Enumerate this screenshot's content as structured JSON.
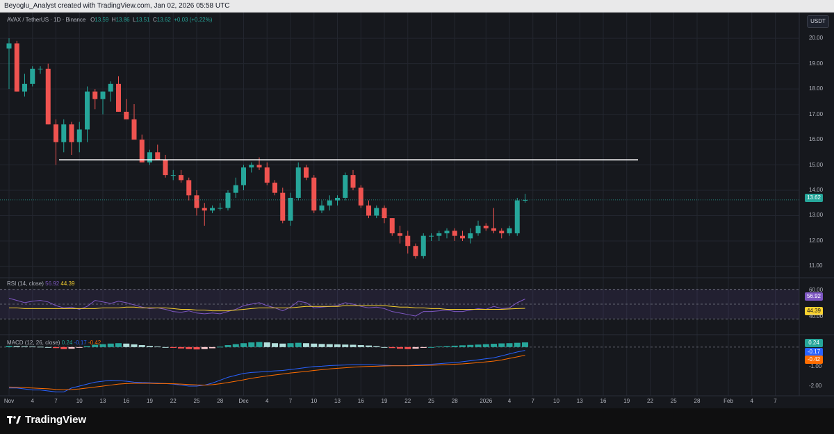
{
  "header": {
    "credit": "Beyoglu_Analyst created with TradingView.com, Jan 02, 2026 05:58 UTC"
  },
  "symbol": {
    "title": "AVAX / TetherUS · 1D · Binance",
    "open_label": "O",
    "open": "13.59",
    "high_label": "H",
    "high": "13.86",
    "low_label": "L",
    "low": "13.51",
    "close_label": "C",
    "close": "13.62",
    "change": "+0.03 (+0.22%)"
  },
  "currency": "USDT",
  "price_axis": [
    "20.00",
    "19.00",
    "18.00",
    "17.00",
    "16.00",
    "15.00",
    "14.00",
    "13.00",
    "12.00",
    "11.00"
  ],
  "last_price": "13.62",
  "rsi": {
    "label": "RSI (14, close)",
    "value": "56.92",
    "ma_value": "44.39",
    "axis": [
      "60.00",
      "40.00"
    ]
  },
  "macd": {
    "label": "MACD (12, 26, close)",
    "hist": "0.24",
    "macd": "-0.17",
    "signal": "-0.42",
    "axis": [
      "-1.00",
      "-2.00"
    ]
  },
  "time_axis": [
    {
      "label": "Nov",
      "day": 0
    },
    {
      "label": "4",
      "day": 3
    },
    {
      "label": "7",
      "day": 6
    },
    {
      "label": "10",
      "day": 9
    },
    {
      "label": "13",
      "day": 12
    },
    {
      "label": "16",
      "day": 15
    },
    {
      "label": "19",
      "day": 18
    },
    {
      "label": "22",
      "day": 21
    },
    {
      "label": "25",
      "day": 24
    },
    {
      "label": "28",
      "day": 27
    },
    {
      "label": "Dec",
      "day": 30
    },
    {
      "label": "4",
      "day": 33
    },
    {
      "label": "7",
      "day": 36
    },
    {
      "label": "10",
      "day": 39
    },
    {
      "label": "13",
      "day": 42
    },
    {
      "label": "16",
      "day": 45
    },
    {
      "label": "19",
      "day": 48
    },
    {
      "label": "22",
      "day": 51
    },
    {
      "label": "25",
      "day": 54
    },
    {
      "label": "28",
      "day": 57
    },
    {
      "label": "2026",
      "day": 61
    },
    {
      "label": "4",
      "day": 64
    },
    {
      "label": "7",
      "day": 67
    },
    {
      "label": "10",
      "day": 70
    },
    {
      "label": "13",
      "day": 73
    },
    {
      "label": "16",
      "day": 76
    },
    {
      "label": "19",
      "day": 79
    },
    {
      "label": "22",
      "day": 82
    },
    {
      "label": "25",
      "day": 85
    },
    {
      "label": "28",
      "day": 88
    },
    {
      "label": "Feb",
      "day": 92
    },
    {
      "label": "4",
      "day": 95
    },
    {
      "label": "7",
      "day": 98
    }
  ],
  "colors": {
    "up": "#26a69a",
    "down": "#ef5350",
    "rsi": "#7e57c2",
    "rsi_ma": "#f9d22f",
    "macd": "#2962ff",
    "signal": "#ff6d00",
    "bg": "#16181d",
    "grid": "#23262f"
  },
  "chart_data": {
    "type": "candlestick",
    "candles": [
      {
        "o": 19.6,
        "h": 20.0,
        "l": 18.0,
        "c": 19.8
      },
      {
        "o": 19.8,
        "h": 19.9,
        "l": 17.9,
        "c": 17.9
      },
      {
        "o": 17.9,
        "h": 18.6,
        "l": 17.7,
        "c": 18.2
      },
      {
        "o": 18.2,
        "h": 18.9,
        "l": 18.1,
        "c": 18.8
      },
      {
        "o": 18.8,
        "h": 18.9,
        "l": 18.6,
        "c": 18.8
      },
      {
        "o": 18.8,
        "h": 19.0,
        "l": 16.6,
        "c": 16.6
      },
      {
        "o": 16.6,
        "h": 16.8,
        "l": 15.0,
        "c": 15.9
      },
      {
        "o": 15.9,
        "h": 16.8,
        "l": 15.5,
        "c": 16.6
      },
      {
        "o": 16.6,
        "h": 16.7,
        "l": 15.4,
        "c": 15.9
      },
      {
        "o": 15.9,
        "h": 16.7,
        "l": 15.5,
        "c": 16.4
      },
      {
        "o": 16.4,
        "h": 18.1,
        "l": 15.9,
        "c": 17.9
      },
      {
        "o": 17.9,
        "h": 18.0,
        "l": 17.2,
        "c": 17.6
      },
      {
        "o": 17.6,
        "h": 17.9,
        "l": 17.0,
        "c": 17.9
      },
      {
        "o": 17.9,
        "h": 18.3,
        "l": 17.5,
        "c": 18.2
      },
      {
        "o": 18.2,
        "h": 18.5,
        "l": 17.1,
        "c": 17.1
      },
      {
        "o": 17.1,
        "h": 17.6,
        "l": 16.8,
        "c": 16.8
      },
      {
        "o": 16.8,
        "h": 17.4,
        "l": 16.0,
        "c": 16.0
      },
      {
        "o": 16.0,
        "h": 16.2,
        "l": 15.1,
        "c": 15.1
      },
      {
        "o": 15.1,
        "h": 15.6,
        "l": 15.0,
        "c": 15.5
      },
      {
        "o": 15.5,
        "h": 15.8,
        "l": 15.2,
        "c": 15.2
      },
      {
        "o": 15.2,
        "h": 15.4,
        "l": 14.5,
        "c": 14.6
      },
      {
        "o": 14.6,
        "h": 14.8,
        "l": 14.4,
        "c": 14.6
      },
      {
        "o": 14.6,
        "h": 14.8,
        "l": 14.3,
        "c": 14.4
      },
      {
        "o": 14.4,
        "h": 14.5,
        "l": 13.6,
        "c": 13.8
      },
      {
        "o": 13.8,
        "h": 14.0,
        "l": 13.0,
        "c": 13.3
      },
      {
        "o": 13.3,
        "h": 13.5,
        "l": 12.6,
        "c": 13.2
      },
      {
        "o": 13.2,
        "h": 13.4,
        "l": 13.1,
        "c": 13.3
      },
      {
        "o": 13.3,
        "h": 13.5,
        "l": 13.2,
        "c": 13.3
      },
      {
        "o": 13.3,
        "h": 14.0,
        "l": 13.2,
        "c": 13.9
      },
      {
        "o": 13.9,
        "h": 14.5,
        "l": 13.7,
        "c": 14.2
      },
      {
        "o": 14.2,
        "h": 15.0,
        "l": 14.0,
        "c": 14.9
      },
      {
        "o": 14.9,
        "h": 15.1,
        "l": 14.7,
        "c": 15.0
      },
      {
        "o": 15.0,
        "h": 15.3,
        "l": 14.8,
        "c": 14.9
      },
      {
        "o": 14.9,
        "h": 15.1,
        "l": 14.2,
        "c": 14.3
      },
      {
        "o": 14.3,
        "h": 14.4,
        "l": 13.8,
        "c": 13.9
      },
      {
        "o": 13.9,
        "h": 14.1,
        "l": 12.7,
        "c": 12.8
      },
      {
        "o": 12.8,
        "h": 13.9,
        "l": 12.6,
        "c": 13.7
      },
      {
        "o": 13.7,
        "h": 15.1,
        "l": 13.6,
        "c": 14.9
      },
      {
        "o": 14.9,
        "h": 15.0,
        "l": 14.4,
        "c": 14.5
      },
      {
        "o": 14.5,
        "h": 14.6,
        "l": 13.1,
        "c": 13.2
      },
      {
        "o": 13.2,
        "h": 13.6,
        "l": 13.1,
        "c": 13.4
      },
      {
        "o": 13.4,
        "h": 13.8,
        "l": 13.2,
        "c": 13.6
      },
      {
        "o": 13.6,
        "h": 13.8,
        "l": 13.4,
        "c": 13.7
      },
      {
        "o": 13.7,
        "h": 14.7,
        "l": 13.6,
        "c": 14.6
      },
      {
        "o": 14.6,
        "h": 14.8,
        "l": 14.0,
        "c": 14.1
      },
      {
        "o": 14.1,
        "h": 14.2,
        "l": 13.3,
        "c": 13.4
      },
      {
        "o": 13.4,
        "h": 13.6,
        "l": 12.9,
        "c": 13.0
      },
      {
        "o": 13.0,
        "h": 13.4,
        "l": 12.9,
        "c": 13.3
      },
      {
        "o": 13.3,
        "h": 13.4,
        "l": 12.7,
        "c": 12.9
      },
      {
        "o": 12.9,
        "h": 12.9,
        "l": 12.2,
        "c": 12.3
      },
      {
        "o": 12.3,
        "h": 12.6,
        "l": 11.9,
        "c": 12.2
      },
      {
        "o": 12.2,
        "h": 12.4,
        "l": 11.5,
        "c": 11.8
      },
      {
        "o": 11.8,
        "h": 11.9,
        "l": 11.3,
        "c": 11.4
      },
      {
        "o": 11.4,
        "h": 12.3,
        "l": 11.3,
        "c": 12.2
      },
      {
        "o": 12.2,
        "h": 12.3,
        "l": 12.0,
        "c": 12.2
      },
      {
        "o": 12.2,
        "h": 12.4,
        "l": 12.0,
        "c": 12.3
      },
      {
        "o": 12.3,
        "h": 12.5,
        "l": 12.1,
        "c": 12.4
      },
      {
        "o": 12.4,
        "h": 12.5,
        "l": 12.0,
        "c": 12.2
      },
      {
        "o": 12.2,
        "h": 12.4,
        "l": 12.0,
        "c": 12.1
      },
      {
        "o": 12.1,
        "h": 12.5,
        "l": 11.9,
        "c": 12.3
      },
      {
        "o": 12.3,
        "h": 12.8,
        "l": 12.2,
        "c": 12.6
      },
      {
        "o": 12.6,
        "h": 12.7,
        "l": 12.4,
        "c": 12.5
      },
      {
        "o": 12.5,
        "h": 13.3,
        "l": 12.3,
        "c": 12.4
      },
      {
        "o": 12.4,
        "h": 12.5,
        "l": 12.1,
        "c": 12.3
      },
      {
        "o": 12.3,
        "h": 12.6,
        "l": 12.2,
        "c": 12.5
      },
      {
        "o": 12.3,
        "h": 13.7,
        "l": 12.2,
        "c": 13.6
      },
      {
        "o": 13.59,
        "h": 13.86,
        "l": 13.51,
        "c": 13.62
      }
    ],
    "resistance_level": 15.2,
    "ylim": [
      10.6,
      20.8
    ],
    "rsi": [
      58,
      55,
      52,
      54,
      55,
      53,
      48,
      45,
      46,
      43,
      47,
      55,
      53,
      51,
      54,
      52,
      49,
      46,
      44,
      45,
      43,
      40,
      39,
      41,
      38,
      37,
      38,
      37,
      40,
      43,
      48,
      50,
      52,
      48,
      45,
      41,
      46,
      54,
      52,
      45,
      46,
      47,
      48,
      52,
      50,
      47,
      45,
      46,
      44,
      40,
      38,
      36,
      34,
      40,
      40,
      41,
      42,
      40,
      40,
      42,
      44,
      43,
      47,
      44,
      45,
      52,
      56.92
    ],
    "rsi_ma": [
      45,
      45,
      44,
      44,
      44,
      44,
      44,
      44,
      44,
      44,
      44,
      44,
      45,
      45,
      45,
      46,
      46,
      45,
      45,
      45,
      45,
      44,
      43,
      43,
      42,
      42,
      41,
      41,
      41,
      42,
      43,
      44,
      45,
      45,
      45,
      45,
      45,
      46,
      47,
      47,
      47,
      47,
      47,
      48,
      48,
      48,
      48,
      48,
      48,
      47,
      46,
      46,
      45,
      45,
      44,
      44,
      43,
      43,
      43,
      43,
      43,
      43,
      43,
      43,
      43.5,
      44,
      44.39
    ],
    "rsi_ylim": [
      20,
      80
    ],
    "macd_hist": [
      0.06,
      0.05,
      0.04,
      0.03,
      0.02,
      0.0,
      -0.05,
      -0.1,
      -0.08,
      -0.03,
      0.05,
      0.12,
      0.15,
      0.18,
      0.2,
      0.18,
      0.14,
      0.1,
      0.06,
      0.03,
      0.0,
      -0.04,
      -0.07,
      -0.1,
      -0.12,
      -0.1,
      -0.06,
      0.02,
      0.1,
      0.15,
      0.2,
      0.24,
      0.26,
      0.24,
      0.2,
      0.18,
      0.2,
      0.22,
      0.2,
      0.18,
      0.16,
      0.15,
      0.14,
      0.13,
      0.12,
      0.1,
      0.08,
      0.05,
      0.0,
      -0.05,
      -0.08,
      -0.1,
      -0.08,
      -0.04,
      0.0,
      0.03,
      0.05,
      0.07,
      0.09,
      0.11,
      0.13,
      0.15,
      0.17,
      0.19,
      0.2,
      0.22,
      0.24
    ],
    "macd_line": [
      -2.1,
      -2.1,
      -2.15,
      -2.2,
      -2.2,
      -2.25,
      -2.3,
      -2.3,
      -2.1,
      -2.0,
      -1.9,
      -1.8,
      -1.75,
      -1.7,
      -1.72,
      -1.75,
      -1.8,
      -1.82,
      -1.83,
      -1.85,
      -1.87,
      -1.9,
      -1.95,
      -2.0,
      -2.0,
      -1.95,
      -1.85,
      -1.7,
      -1.55,
      -1.45,
      -1.35,
      -1.3,
      -1.28,
      -1.25,
      -1.22,
      -1.2,
      -1.15,
      -1.1,
      -1.05,
      -1.0,
      -0.98,
      -0.95,
      -0.93,
      -0.92,
      -0.9,
      -0.9,
      -0.9,
      -0.92,
      -0.93,
      -0.95,
      -0.95,
      -0.95,
      -0.92,
      -0.9,
      -0.88,
      -0.85,
      -0.82,
      -0.8,
      -0.75,
      -0.7,
      -0.65,
      -0.6,
      -0.55,
      -0.45,
      -0.35,
      -0.25,
      -0.17
    ],
    "signal_line": [
      -2.05,
      -2.06,
      -2.08,
      -2.1,
      -2.12,
      -2.14,
      -2.17,
      -2.19,
      -2.18,
      -2.15,
      -2.1,
      -2.05,
      -2.0,
      -1.95,
      -1.9,
      -1.87,
      -1.86,
      -1.86,
      -1.86,
      -1.87,
      -1.87,
      -1.88,
      -1.9,
      -1.92,
      -1.94,
      -1.95,
      -1.93,
      -1.88,
      -1.82,
      -1.75,
      -1.68,
      -1.6,
      -1.54,
      -1.48,
      -1.43,
      -1.38,
      -1.33,
      -1.29,
      -1.25,
      -1.2,
      -1.16,
      -1.12,
      -1.09,
      -1.06,
      -1.03,
      -1.01,
      -0.99,
      -0.98,
      -0.97,
      -0.96,
      -0.96,
      -0.96,
      -0.95,
      -0.94,
      -0.93,
      -0.92,
      -0.9,
      -0.88,
      -0.86,
      -0.83,
      -0.8,
      -0.76,
      -0.72,
      -0.66,
      -0.58,
      -0.5,
      -0.42
    ],
    "macd_ylim": [
      -2.5,
      0.6
    ]
  }
}
